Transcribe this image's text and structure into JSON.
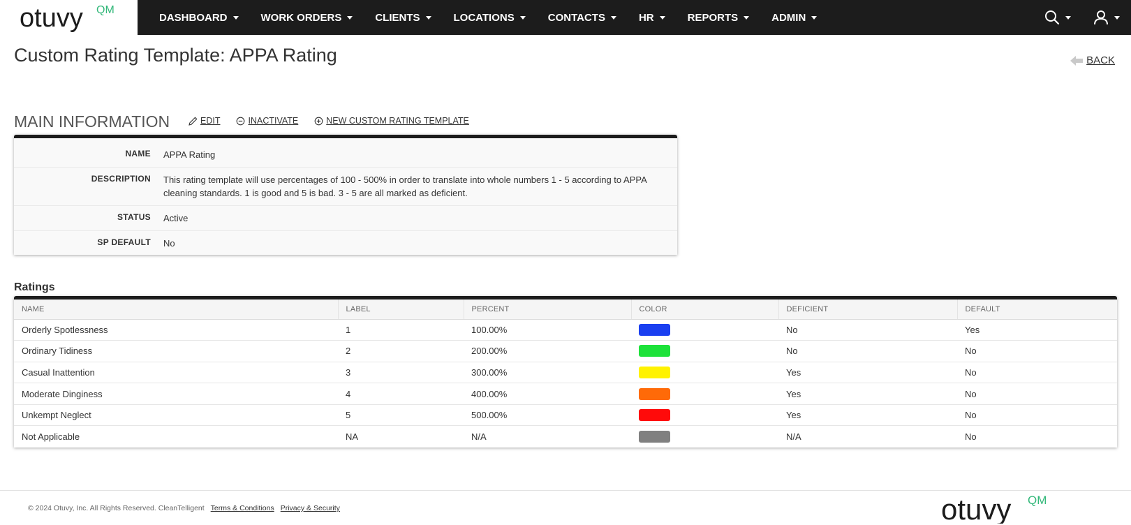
{
  "brand": {
    "logo_text": "otuvy",
    "logo_suffix": "QM",
    "logo_color": "#1c1c1c",
    "accent": "#33b87a"
  },
  "nav": {
    "items": [
      {
        "label": "DASHBOARD"
      },
      {
        "label": "WORK ORDERS"
      },
      {
        "label": "CLIENTS"
      },
      {
        "label": "LOCATIONS"
      },
      {
        "label": "CONTACTS"
      },
      {
        "label": "HR"
      },
      {
        "label": "REPORTS"
      },
      {
        "label": "ADMIN"
      }
    ],
    "icons": [
      "search-icon",
      "user-icon"
    ]
  },
  "header": {
    "title": "Custom Rating Template: APPA Rating",
    "back_label": "BACK"
  },
  "main_info": {
    "title": "MAIN INFORMATION",
    "actions": {
      "edit": "EDIT",
      "inactivate": "INACTIVATE",
      "new_template": "NEW CUSTOM RATING TEMPLATE"
    },
    "fields": {
      "name": {
        "label": "NAME",
        "value": "APPA Rating"
      },
      "description": {
        "label": "DESCRIPTION",
        "value": "This rating template will use percentages of 100 - 500% in order to translate into whole numbers 1 - 5 according to APPA cleaning standards. 1 is good and 5 is bad. 3 - 5 are all marked as deficient."
      },
      "status": {
        "label": "STATUS",
        "value": "Active"
      },
      "sp_default": {
        "label": "SP DEFAULT",
        "value": "No"
      }
    }
  },
  "ratings": {
    "title": "Ratings",
    "columns": {
      "name": "NAME",
      "label": "LABEL",
      "percent": "PERCENT",
      "color": "COLOR",
      "deficient": "DEFICIENT",
      "default": "DEFAULT"
    },
    "rows": [
      {
        "name": "Orderly Spotlessness",
        "label": "1",
        "percent": "100.00%",
        "color": "#1a3ff0",
        "deficient": "No",
        "default": "Yes"
      },
      {
        "name": "Ordinary Tidiness",
        "label": "2",
        "percent": "200.00%",
        "color": "#1de23a",
        "deficient": "No",
        "default": "No"
      },
      {
        "name": "Casual Inattention",
        "label": "3",
        "percent": "300.00%",
        "color": "#fff200",
        "deficient": "Yes",
        "default": "No"
      },
      {
        "name": "Moderate Dinginess",
        "label": "4",
        "percent": "400.00%",
        "color": "#ff6a08",
        "deficient": "Yes",
        "default": "No"
      },
      {
        "name": "Unkempt Neglect",
        "label": "5",
        "percent": "500.00%",
        "color": "#ff0a0a",
        "deficient": "Yes",
        "default": "No"
      },
      {
        "name": "Not Applicable",
        "label": "NA",
        "percent": "N/A",
        "color": "#808080",
        "deficient": "N/A",
        "default": "No"
      }
    ]
  },
  "footer": {
    "copyright": "© 2024 Otuvy, Inc. All Rights Reserved. CleanTelligent",
    "terms": "Terms & Conditions",
    "privacy": "Privacy & Security"
  }
}
